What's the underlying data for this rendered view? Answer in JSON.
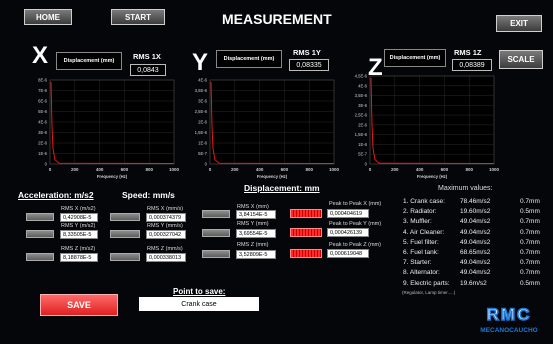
{
  "header": {
    "home_label": "HOME",
    "start_label": "START",
    "title": "MEASUREMENT",
    "exit_label": "EXIT",
    "scale_label": "SCALE"
  },
  "axes": [
    {
      "letter": "X",
      "disp_label": "Displacement (mm)",
      "rms_label": "RMS 1X",
      "rms_value": "0,0843",
      "yticks": [
        "8E-6",
        "7E-6",
        "6E-6",
        "5E-6",
        "4E-6",
        "3E-6",
        "2E-6",
        "1E-6",
        "0"
      ]
    },
    {
      "letter": "Y",
      "disp_label": "Displacement (mm)",
      "rms_label": "RMS 1Y",
      "rms_value": "0,08335",
      "yticks": [
        "4E-6",
        "3,5E-6",
        "3E-6",
        "2,5E-6",
        "2E-6",
        "1,5E-6",
        "1E-6",
        "5E-7",
        "0"
      ]
    },
    {
      "letter": "Z",
      "disp_label": "Displacement (mm)",
      "rms_label": "RMS 1Z",
      "rms_value": "0,08389",
      "yticks": [
        "4,5E-6",
        "4E-6",
        "3,5E-6",
        "3E-6",
        "2,5E-6",
        "2E-6",
        "1,5E-6",
        "1E-6",
        "5E-7",
        "0"
      ]
    }
  ],
  "xticks": [
    "0",
    "200",
    "400",
    "600",
    "800",
    "1000"
  ],
  "xlabel": "Frequency (Hz)",
  "acceleration": {
    "title": "Acceleration: m/s2",
    "rows": [
      {
        "label": "RMS X (m/s2)",
        "value": "0,42908E-5"
      },
      {
        "label": "RMS Y (m/s2)",
        "value": "8,33505E-5"
      },
      {
        "label": "RMS Z (m/s2)",
        "value": "8,18878E-5"
      }
    ]
  },
  "speed": {
    "title": "Speed: mm/s",
    "rows": [
      {
        "label": "RMS X (mm/s)",
        "value": "0,000374379"
      },
      {
        "label": "RMS Y (mm/s)",
        "value": "0,000327042"
      },
      {
        "label": "RMS Z (mm/s)",
        "value": "0,000338013"
      }
    ]
  },
  "displacement": {
    "title": "Displacement: mm",
    "rows": [
      {
        "label": "RMS X (mm)",
        "value": "3,84154E-5",
        "p2p_label": "Peak to Peak X (mm)",
        "p2p_value": "0,000404619"
      },
      {
        "label": "RMS Y (mm)",
        "value": "3,69554E-5",
        "p2p_label": "Peak to Peak Y (mm)",
        "p2p_value": "0,000426139"
      },
      {
        "label": "RMS Z (mm)",
        "value": "3,52809E-5",
        "p2p_label": "Peak to Peak Z (mm)",
        "p2p_value": "0,000619048"
      }
    ]
  },
  "max_values": {
    "title": "Maximum values:",
    "rows": [
      {
        "name": "1. Crank case:",
        "accel": "78.46m/s2",
        "disp": "0.7mm"
      },
      {
        "name": "2. Radiator:",
        "accel": "19.60m/s2",
        "disp": "0.5mm"
      },
      {
        "name": "3. Muffler:",
        "accel": "49.04m/s2",
        "disp": "0.7mm"
      },
      {
        "name": "4. Air Cleaner:",
        "accel": "49.04m/s2",
        "disp": "0.7mm"
      },
      {
        "name": "5. Fuel filter:",
        "accel": "49.04m/s2",
        "disp": "0.7mm"
      },
      {
        "name": "6. Fuel tank:",
        "accel": "68.65m/s2",
        "disp": "0.7mm"
      },
      {
        "name": "7. Starter:",
        "accel": "49.04m/s2",
        "disp": "0.7mm"
      },
      {
        "name": "8. Alternator:",
        "accel": "49.04m/s2",
        "disp": "0.7mm"
      },
      {
        "name": "9. Electric parts:",
        "accel": "19.6m/s2",
        "disp": "0.5mm"
      }
    ],
    "note": "(Regulator, Lamp timer.....)"
  },
  "save_label": "SAVE",
  "point": {
    "title": "Point to save:",
    "value": "Crank case"
  },
  "logo": {
    "letters": "RMC",
    "text": "MECANOCAUCHO",
    "color": "#1e78d6"
  },
  "colors": {
    "trace": "#ff1a1a",
    "accent_red": "#ff3030"
  }
}
